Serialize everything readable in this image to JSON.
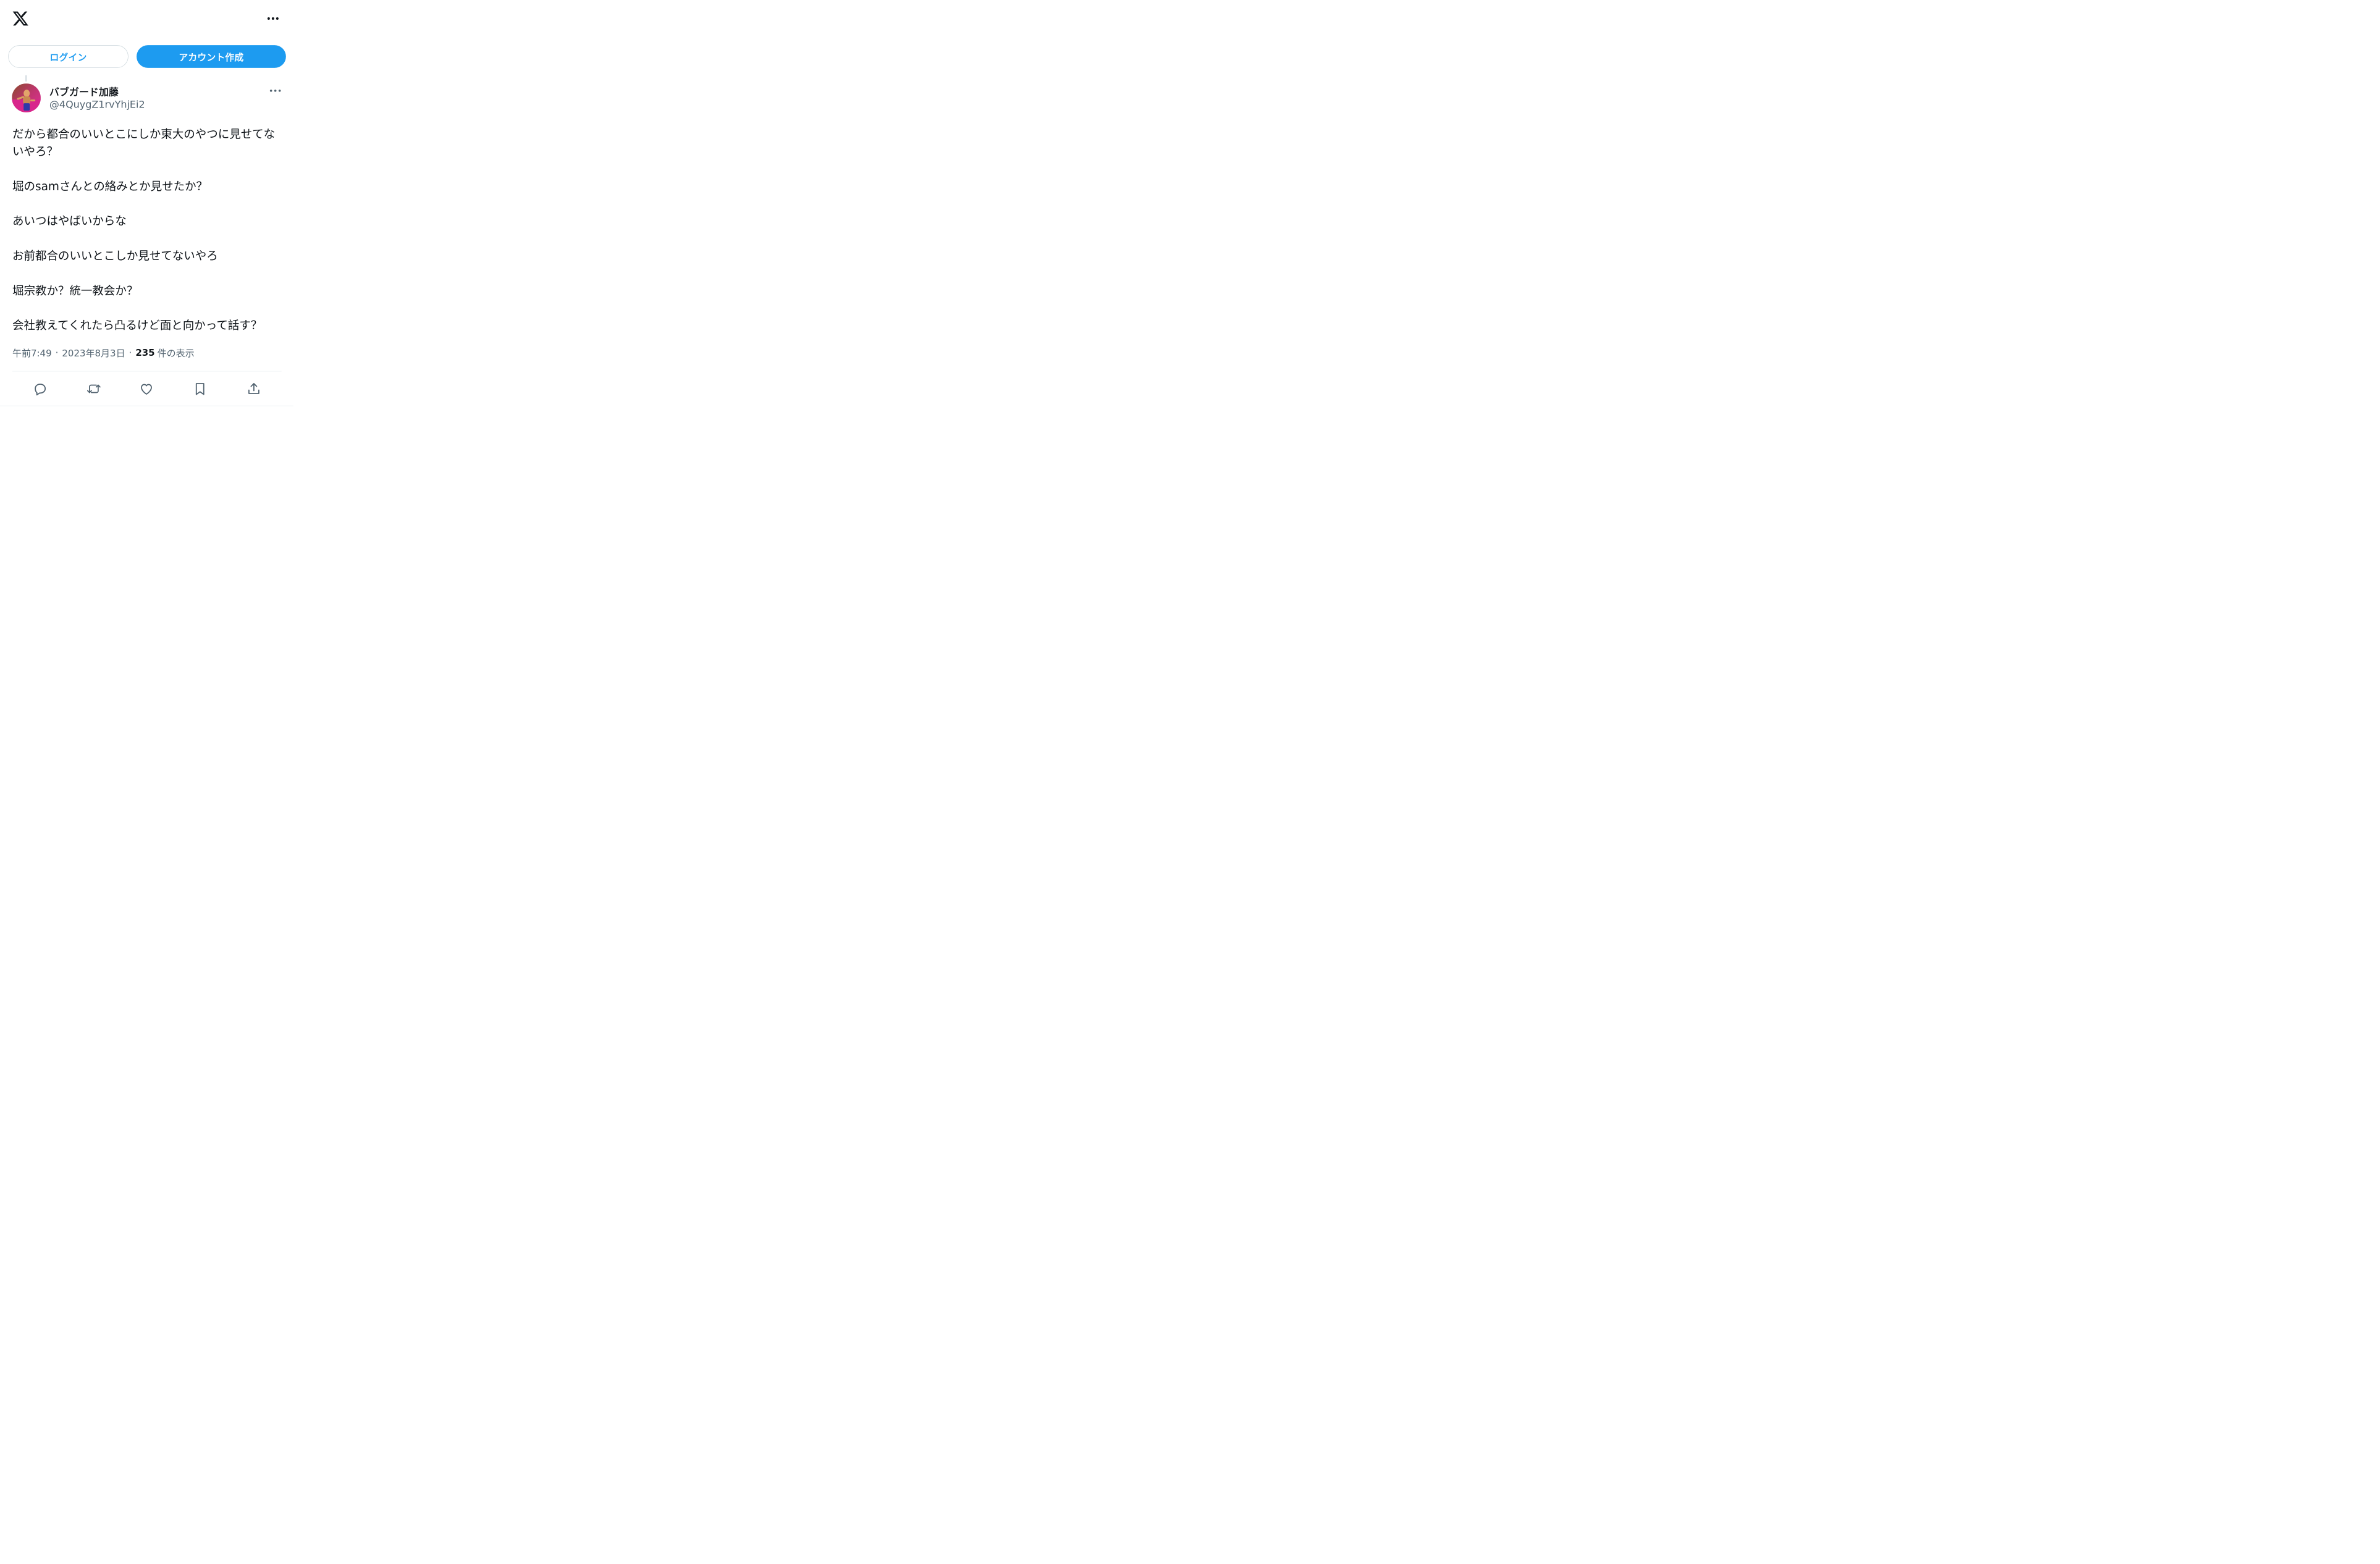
{
  "header": {
    "logo_icon": "x-logo-icon",
    "more_icon": "more-horizontal-icon"
  },
  "auth": {
    "login_label": "ログイン",
    "signup_label": "アカウント作成"
  },
  "tweet": {
    "display_name": "バブガード加藤",
    "handle": "@4QuygZ1rvYhjEi2",
    "text": "だから都合のいいとこにしか東大のやつに見せてないやろ？\n\n堀のsamさんとの絡みとか見せたか？\n\nあいつはやばいからな\n\nお前都合のいいとこしか見せてないやろ\n\n堀宗教か？統一教会か？\n\n会社教えてくれたら凸るけど面と向かって話す？",
    "time": "午前7:49",
    "date": "2023年8月3日",
    "views_count": "235",
    "views_label": "件の表示"
  },
  "actions": [
    {
      "name": "reply",
      "icon": "reply-icon"
    },
    {
      "name": "retweet",
      "icon": "retweet-icon"
    },
    {
      "name": "like",
      "icon": "heart-icon"
    },
    {
      "name": "bookmark",
      "icon": "bookmark-icon"
    },
    {
      "name": "share",
      "icon": "share-icon"
    }
  ],
  "colors": {
    "accent": "#1d9bf0",
    "text_primary": "#0f1419",
    "text_secondary": "#536471",
    "border": "#cfd9de",
    "divider": "#eff3f4"
  }
}
